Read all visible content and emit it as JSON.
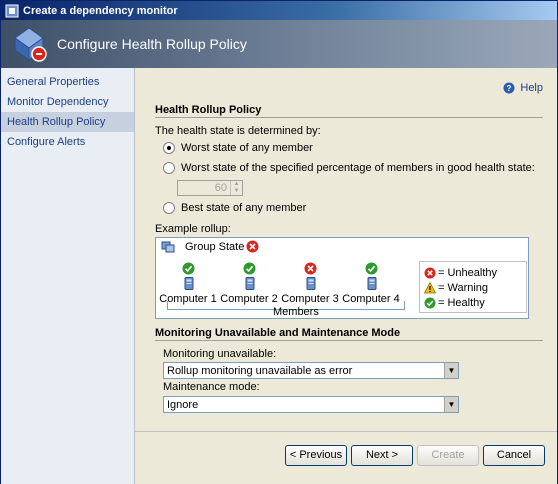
{
  "window": {
    "title": "Create a dependency monitor"
  },
  "banner": {
    "title": "Configure Health Rollup Policy"
  },
  "nav": {
    "items": [
      {
        "label": "General Properties",
        "selected": false
      },
      {
        "label": "Monitor Dependency",
        "selected": false
      },
      {
        "label": "Health Rollup Policy",
        "selected": true
      },
      {
        "label": "Configure Alerts",
        "selected": false
      }
    ]
  },
  "help": {
    "label": "Help"
  },
  "policy": {
    "section_title": "Health Rollup Policy",
    "intro": "The health state is determined by:",
    "options": [
      {
        "label": "Worst state of any member",
        "checked": true
      },
      {
        "label": "Worst state of the specified percentage of members in good health state:",
        "checked": false
      },
      {
        "label": "Best state of any member",
        "checked": false
      }
    ],
    "percentage_value": "60"
  },
  "example": {
    "label": "Example rollup:",
    "group_state_label": "Group State =",
    "group_state": "unhealthy",
    "members_label": "Members",
    "computers": [
      {
        "name": "Computer 1",
        "state": "healthy"
      },
      {
        "name": "Computer 2",
        "state": "healthy"
      },
      {
        "name": "Computer 3",
        "state": "unhealthy"
      },
      {
        "name": "Computer 4",
        "state": "healthy"
      }
    ],
    "legend": {
      "unhealthy": "= Unhealthy",
      "warning": "= Warning",
      "healthy": "= Healthy"
    }
  },
  "maintenance": {
    "section_title": "Monitoring Unavailable and Maintenance Mode",
    "unavailable_label": "Monitoring unavailable:",
    "unavailable_value": "Rollup monitoring unavailable as error",
    "mode_label": "Maintenance mode:",
    "mode_value": "Ignore"
  },
  "buttons": {
    "previous": "< Previous",
    "next": "Next >",
    "create": "Create",
    "cancel": "Cancel"
  },
  "colors": {
    "healthy": "#2e9a2e",
    "unhealthy": "#d9261c",
    "warning": "#f2c200",
    "nav_text": "#1c3f87"
  }
}
